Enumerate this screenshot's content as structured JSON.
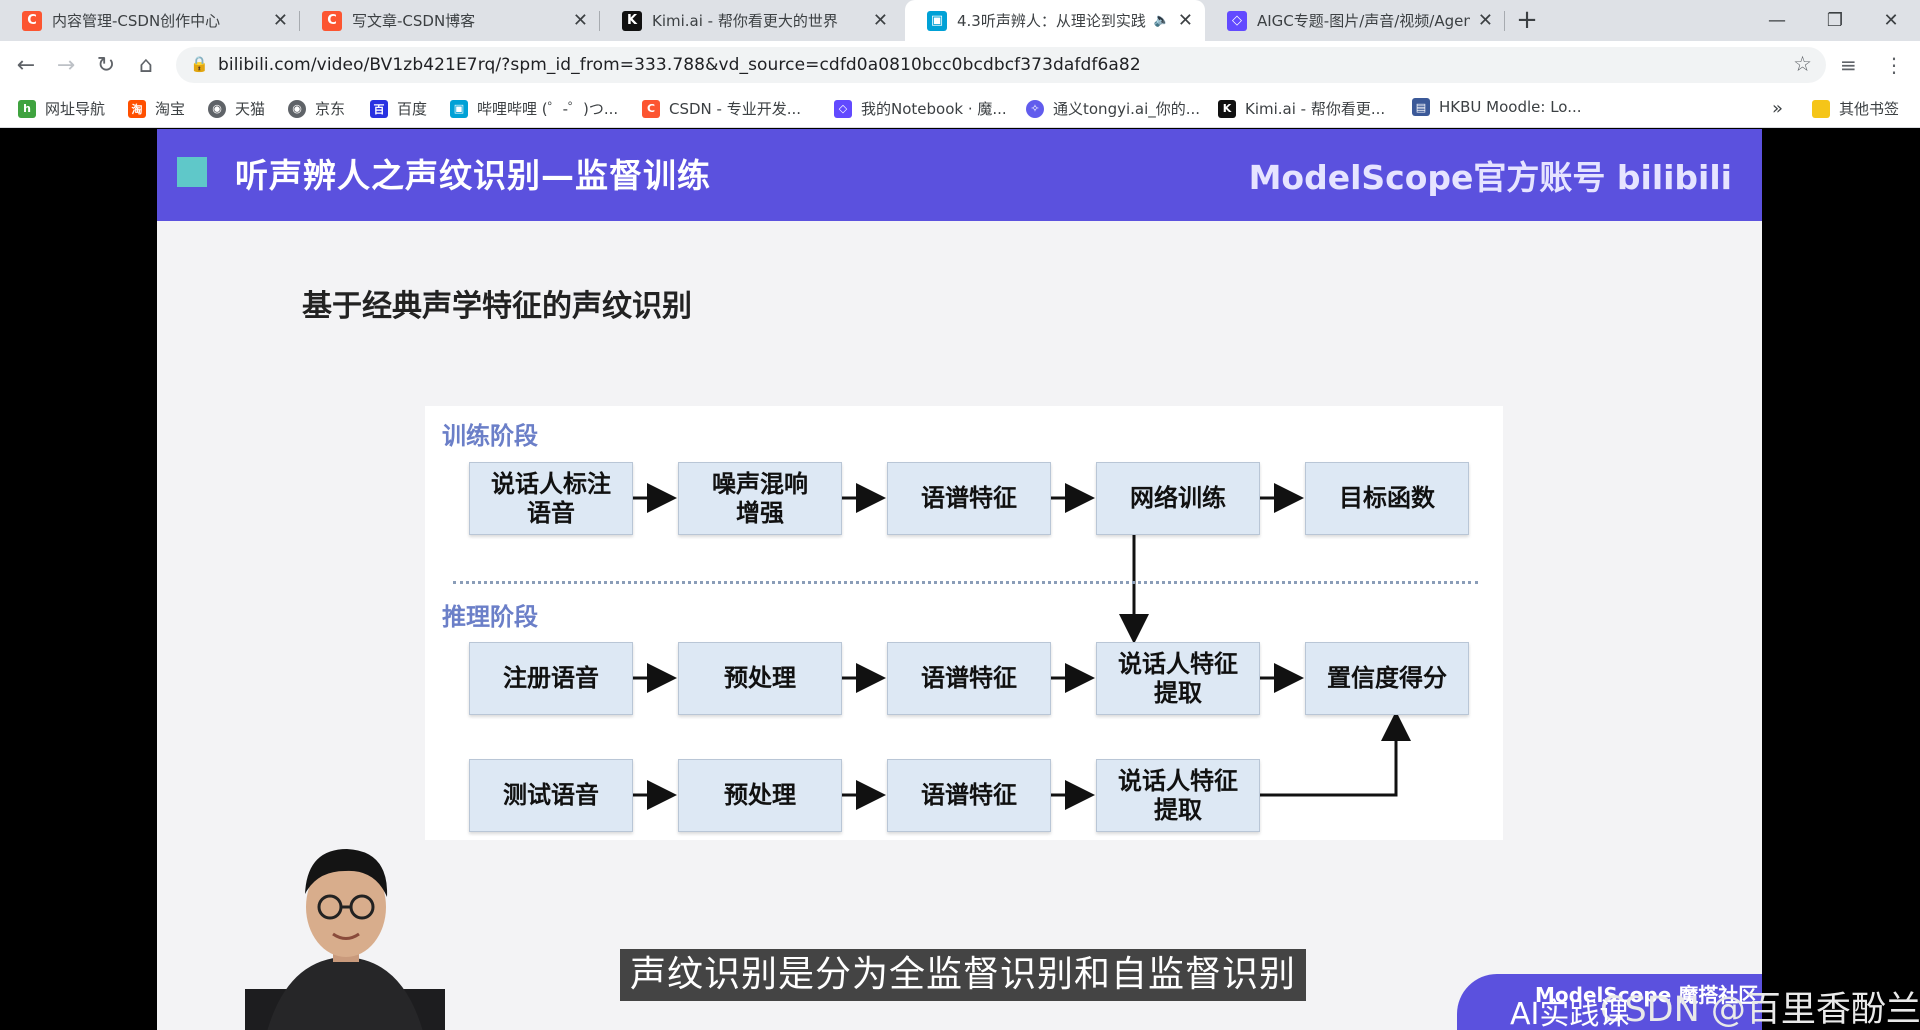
{
  "tabs": [
    {
      "title": "内容管理-CSDN创作中心",
      "icon": "csdn-icon",
      "color": "#fc5531",
      "active": false
    },
    {
      "title": "写文章-CSDN博客",
      "icon": "csdn-icon",
      "color": "#fc5531",
      "active": false
    },
    {
      "title": "Kimi.ai - 帮你看更大的世界",
      "icon": "kimi-icon",
      "color": "#111111",
      "active": false
    },
    {
      "title": "4.3听声辨人：从理论到实践",
      "icon": "bilibili-icon",
      "color": "#00a1d6",
      "active": true
    },
    {
      "title": "AIGC专题-图片/声音/视频/Agen",
      "icon": "modelscope-icon",
      "color": "#624aff",
      "active": false
    }
  ],
  "address_bar": {
    "url": "bilibili.com/video/BV1zb421E7rq/?spm_id_from=333.788&vd_source=cdfd0a0810bcc0bcdbcf373dafdf6a82"
  },
  "bookmarks": [
    {
      "label": "网址导航",
      "icon": "hao123-icon",
      "color": "#3fa33f"
    },
    {
      "label": "淘宝",
      "icon": "taobao-icon",
      "color": "#ff5000"
    },
    {
      "label": "天猫",
      "icon": "globe-icon",
      "color": "#5f6368"
    },
    {
      "label": "京东",
      "icon": "globe-icon",
      "color": "#5f6368"
    },
    {
      "label": "百度",
      "icon": "baidu-icon",
      "color": "#2932e1"
    },
    {
      "label": "哔哩哔哩 (゜-゜)つ...",
      "icon": "bilibili-icon",
      "color": "#00a1d6"
    },
    {
      "label": "CSDN - 专业开发...",
      "icon": "csdn-icon",
      "color": "#fc5531"
    },
    {
      "label": "我的Notebook · 魔...",
      "icon": "modelscope-icon",
      "color": "#624aff"
    },
    {
      "label": "通义tongyi.ai_你的...",
      "icon": "tongyi-icon",
      "color": "#615ced"
    },
    {
      "label": "Kimi.ai - 帮你看更...",
      "icon": "kimi-icon",
      "color": "#111111"
    },
    {
      "label": "HKBU Moodle: Lo...",
      "icon": "moodle-icon",
      "color": "#3b5998"
    }
  ],
  "other_bookmarks": "其他书签",
  "bookmarks_overflow": "»",
  "slide": {
    "header_title": "听声辨人之声纹识别—监督训练",
    "brand": "ModelScope官方账号 bilibili",
    "heading": "基于经典声学特征的声纹识别",
    "training_label": "训练阶段",
    "inference_label": "推理阶段",
    "train_row": [
      "说话人标注\n语音",
      "噪声混响\n增强",
      "语谱特征",
      "网络训练",
      "目标函数"
    ],
    "enroll_row": [
      "注册语音",
      "预处理",
      "语谱特征",
      "说话人特征\n提取",
      "置信度得分"
    ],
    "test_row": [
      "测试语音",
      "预处理",
      "语谱特征",
      "说话人特征\n提取"
    ]
  },
  "caption": "声纹识别是分为全监督识别和自监督识别",
  "modelscope_logo": "ModelScope 魔搭社区",
  "watermark": "CSDN @百里香酚兰",
  "overlay_text": "AI实践课"
}
